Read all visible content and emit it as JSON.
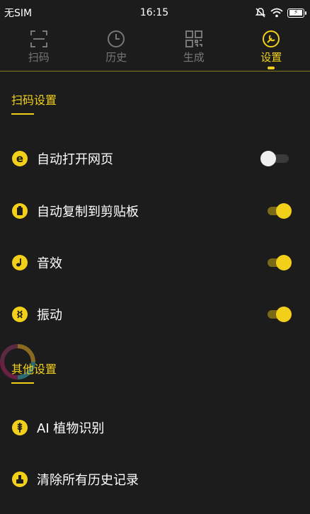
{
  "status_bar": {
    "carrier": "无SIM",
    "time": "16:15",
    "battery_icon": "battery-icon"
  },
  "tabs": [
    {
      "label": "扫码",
      "icon": "scan-icon",
      "active": false
    },
    {
      "label": "历史",
      "icon": "clock-icon",
      "active": false
    },
    {
      "label": "生成",
      "icon": "qrcode-icon",
      "active": false
    },
    {
      "label": "设置",
      "icon": "settings-icon",
      "active": true
    }
  ],
  "scan_settings": {
    "title": "扫码设置",
    "items": [
      {
        "label": "自动打开网页",
        "icon": "browser-e-icon",
        "enabled": false
      },
      {
        "label": "自动复制到剪贴板",
        "icon": "clipboard-icon",
        "enabled": true
      },
      {
        "label": "音效",
        "icon": "sound-icon",
        "enabled": true
      },
      {
        "label": "振动",
        "icon": "vibrate-icon",
        "enabled": true
      }
    ]
  },
  "other_settings": {
    "title": "其他设置",
    "items": [
      {
        "label": "AI 植物识别",
        "icon": "plant-icon"
      },
      {
        "label": "清除所有历史记录",
        "icon": "clear-history-icon"
      }
    ]
  },
  "colors": {
    "accent": "#f2d01a",
    "background": "#1c1c1c",
    "inactive": "#777777"
  }
}
